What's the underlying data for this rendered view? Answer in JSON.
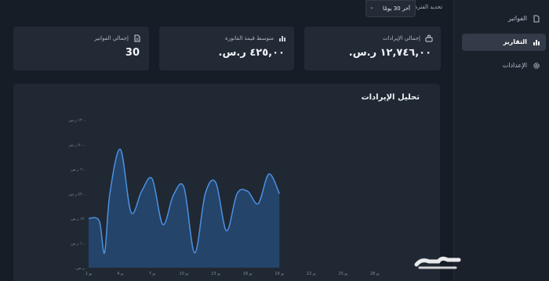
{
  "topbar": {
    "period_label": "تحديد الفترة",
    "period_value": "آخر 30 يومًا"
  },
  "stats": {
    "total_revenue": {
      "title": "إجمالي الإيرادات",
      "value": "١٢,٧٤٦,٠٠ ر.س."
    },
    "avg_invoice": {
      "title": "متوسط قيمة الفاتورة",
      "value": "٤٢٥,٠٠ ر.س."
    },
    "total_invoices": {
      "title": "إجمالي الفواتير",
      "value": "30"
    }
  },
  "sidebar": {
    "items": [
      {
        "label": "الفواتير",
        "icon": "file-icon",
        "active": false
      },
      {
        "label": "التقارير",
        "icon": "bar-chart-icon",
        "active": true
      },
      {
        "label": "الإعدادات",
        "icon": "gear-icon",
        "active": false
      }
    ]
  },
  "chart": {
    "title": "تحليل الإيرادات"
  },
  "chart_data": {
    "type": "area",
    "title": "تحليل الإيرادات",
    "yticks": [
      "١٢٠ ر.س.",
      "٨٠٠ ر.س.",
      "٦٠ ر.س.",
      "٤٢٠ ر.س.",
      "١٢ ر.س.",
      "١٠ ر.س.",
      ". ر.س."
    ],
    "xticks": [
      "1 يو",
      "4 يو",
      "7 يو",
      "10 يو",
      "13 يو",
      "16 يو",
      "19 يو",
      "22 يو",
      "25 يو",
      "28 يو"
    ],
    "xlim": [
      1,
      30
    ],
    "ylim": [
      0,
      1200
    ],
    "series": [
      {
        "x": [
          1,
          2,
          2.5,
          3,
          4,
          5,
          6,
          7,
          8,
          9,
          10,
          11,
          12,
          13,
          14,
          15,
          16,
          17,
          18,
          19
        ],
        "values": [
          400,
          380,
          120,
          600,
          960,
          450,
          620,
          720,
          350,
          590,
          650,
          120,
          600,
          690,
          300,
          600,
          620,
          520,
          760,
          600
        ]
      }
    ],
    "colors": {
      "line": "#4a90e2",
      "fill": "#274e7d"
    }
  },
  "watermark": {
    "text": "حراج"
  }
}
